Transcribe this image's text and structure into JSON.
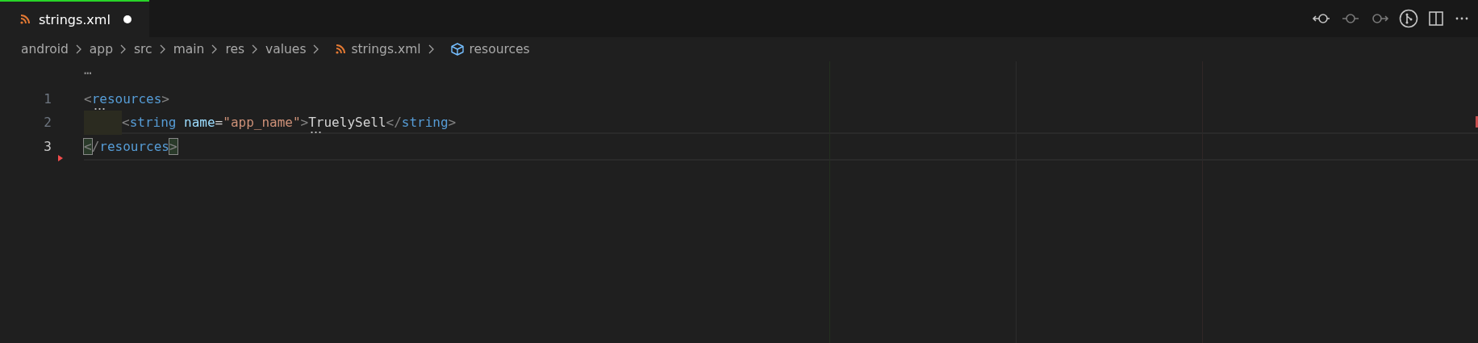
{
  "tabs": [
    {
      "label": "strings.xml",
      "selected": true,
      "modified": true
    }
  ],
  "breadcrumbs": [
    {
      "label": "android",
      "kind": "folder"
    },
    {
      "label": "app",
      "kind": "folder"
    },
    {
      "label": "src",
      "kind": "folder"
    },
    {
      "label": "main",
      "kind": "folder"
    },
    {
      "label": "res",
      "kind": "folder"
    },
    {
      "label": "values",
      "kind": "folder"
    },
    {
      "label": "strings.xml",
      "kind": "file"
    },
    {
      "label": "resources",
      "kind": "symbol"
    }
  ],
  "fold_hint": "…",
  "lines": [
    {
      "number": "1",
      "active": false,
      "indented": false,
      "marker": false,
      "tokens": [
        {
          "text": "<",
          "kind": "punct",
          "matched": false,
          "hint": false
        },
        {
          "text": "resources",
          "kind": "tag",
          "matched": false,
          "hint": true
        },
        {
          "text": ">",
          "kind": "punct",
          "matched": false,
          "hint": false
        }
      ]
    },
    {
      "number": "2",
      "active": false,
      "indented": true,
      "marker": false,
      "tokens": [
        {
          "text": "<",
          "kind": "punct",
          "matched": false,
          "hint": false
        },
        {
          "text": "string",
          "kind": "tag",
          "matched": false,
          "hint": false
        },
        {
          "text": " name",
          "kind": "attr",
          "matched": false,
          "hint": false
        },
        {
          "text": "=",
          "kind": "text",
          "matched": false,
          "hint": false
        },
        {
          "text": "\"app_name\"",
          "kind": "string",
          "matched": false,
          "hint": false
        },
        {
          "text": ">",
          "kind": "punct",
          "matched": false,
          "hint": false
        },
        {
          "text": "TruelySell",
          "kind": "text",
          "matched": false,
          "hint": true
        },
        {
          "text": "</",
          "kind": "punct",
          "matched": false,
          "hint": false
        },
        {
          "text": "string",
          "kind": "tag",
          "matched": false,
          "hint": false
        },
        {
          "text": ">",
          "kind": "punct",
          "matched": false,
          "hint": false
        }
      ]
    },
    {
      "number": "3",
      "active": true,
      "indented": false,
      "marker": true,
      "tokens": [
        {
          "text": "<",
          "kind": "punct",
          "matched": true,
          "hint": false
        },
        {
          "text": "/",
          "kind": "punct",
          "matched": false,
          "hint": false
        },
        {
          "text": "resources",
          "kind": "tag",
          "matched": false,
          "hint": false
        },
        {
          "text": ">",
          "kind": "punct",
          "matched": true,
          "hint": false
        }
      ]
    }
  ]
}
